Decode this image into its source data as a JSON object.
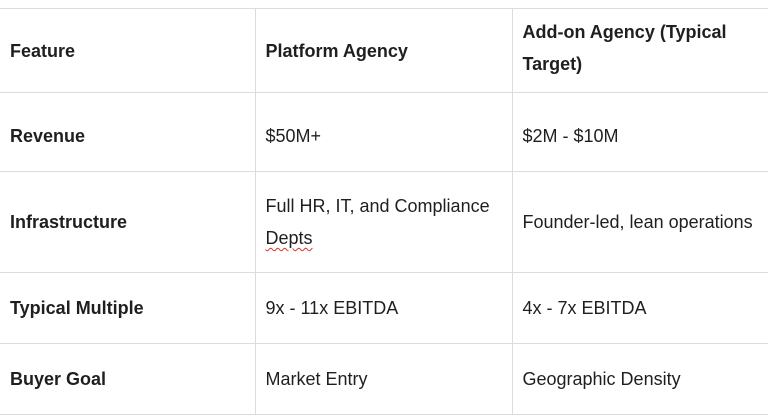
{
  "table": {
    "headers": [
      "Feature",
      "Platform Agency",
      "Add-on Agency (Typical Target)"
    ],
    "rows": [
      {
        "feature": "Revenue",
        "platform": "$50M+",
        "addon": "$2M - $10M"
      },
      {
        "feature": "Infrastructure",
        "platform_part1": "Full HR, IT, and Compliance ",
        "platform_part2": "Depts",
        "addon": "Founder-led, lean operations"
      },
      {
        "feature": "Typical Multiple",
        "platform": "9x - 11x EBITDA",
        "addon": "4x - 7x EBITDA"
      },
      {
        "feature": "Buyer Goal",
        "platform": "Market Entry",
        "addon": "Geographic Density"
      }
    ]
  },
  "colors": {
    "text": "#1f1f1f",
    "border": "#dadce0",
    "spellcheck": "#d93025"
  }
}
